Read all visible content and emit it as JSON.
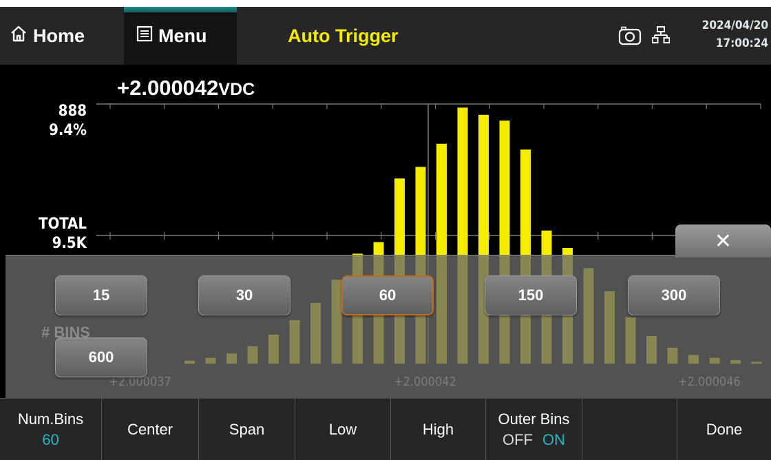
{
  "topbar": {
    "home_label": "Home",
    "menu_label": "Menu",
    "trigger_mode": "Auto Trigger",
    "date": "2024/04/20",
    "time": "17:00:24",
    "icons": [
      "home-icon",
      "menu-icon",
      "camera-icon",
      "network-icon"
    ]
  },
  "reading": {
    "value": "+2.000042",
    "unit": "VDC"
  },
  "histogram": {
    "max_count": "888",
    "max_percent": "9.4%",
    "total_label": "TOTAL",
    "total_value": "9.5K",
    "bins_label": "# BINS",
    "x_min": "+2.000037",
    "x_center": "+2.000042",
    "x_max": "+2.000046",
    "bar_color": "#f5ec00"
  },
  "chart_data": {
    "type": "bar",
    "title": "",
    "xlabel": "",
    "ylabel": "",
    "ylim": [
      0,
      888
    ],
    "x_ticks": [
      "+2.000037",
      "+2.000042",
      "+2.000046"
    ],
    "values": [
      0,
      0,
      0,
      0,
      10,
      20,
      35,
      60,
      100,
      150,
      210,
      290,
      380,
      420,
      640,
      680,
      760,
      885,
      860,
      840,
      740,
      460,
      400,
      330,
      250,
      160,
      95,
      55,
      30,
      20,
      12,
      6,
      3,
      1
    ]
  },
  "bins_panel": {
    "options": [
      "15",
      "30",
      "60",
      "150",
      "300",
      "600"
    ],
    "selected": "60",
    "close_label": "✕"
  },
  "softkeys": {
    "num_bins": {
      "label": "Num.Bins",
      "value": "60"
    },
    "center": "Center",
    "span": "Span",
    "low": "Low",
    "high": "High",
    "outer_bins": {
      "label": "Outer Bins",
      "off": "OFF",
      "on": "ON"
    },
    "done": "Done"
  }
}
